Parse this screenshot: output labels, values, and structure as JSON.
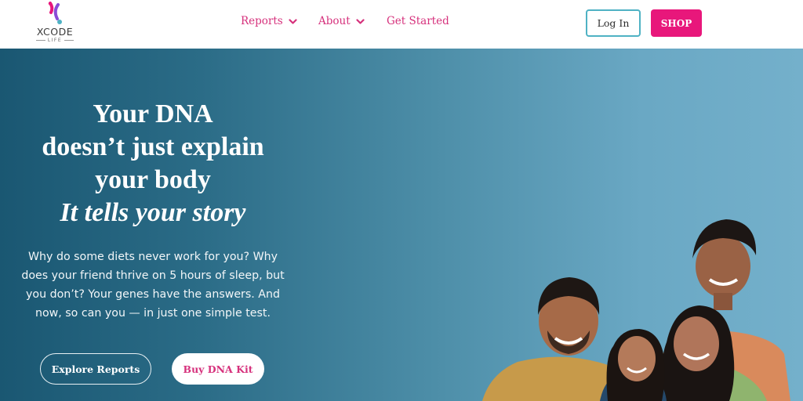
{
  "brand": {
    "logo_text": "XCODE",
    "logo_sub": "LIFE",
    "colors": {
      "pink": "#d6317c",
      "shop": "#e8177b",
      "teal": "#4fb2c4"
    }
  },
  "nav": {
    "items": [
      {
        "label": "Reports",
        "has_dropdown": true
      },
      {
        "label": "About",
        "has_dropdown": true
      },
      {
        "label": "Get Started",
        "has_dropdown": false
      }
    ]
  },
  "header": {
    "login_label": "Log In",
    "shop_label": "SHOP"
  },
  "hero": {
    "headline": {
      "line1": "Your DNA",
      "line2": "doesn’t just explain",
      "line3": "your body",
      "line4": "It tells your story"
    },
    "body": "Why do some diets never work for you? Why does your friend thrive on 5 hours of sleep, but you don’t? Your genes have the answers. And now, so can you — in just one simple test.",
    "explore_label": "Explore Reports",
    "buy_label": "Buy DNA Kit"
  }
}
